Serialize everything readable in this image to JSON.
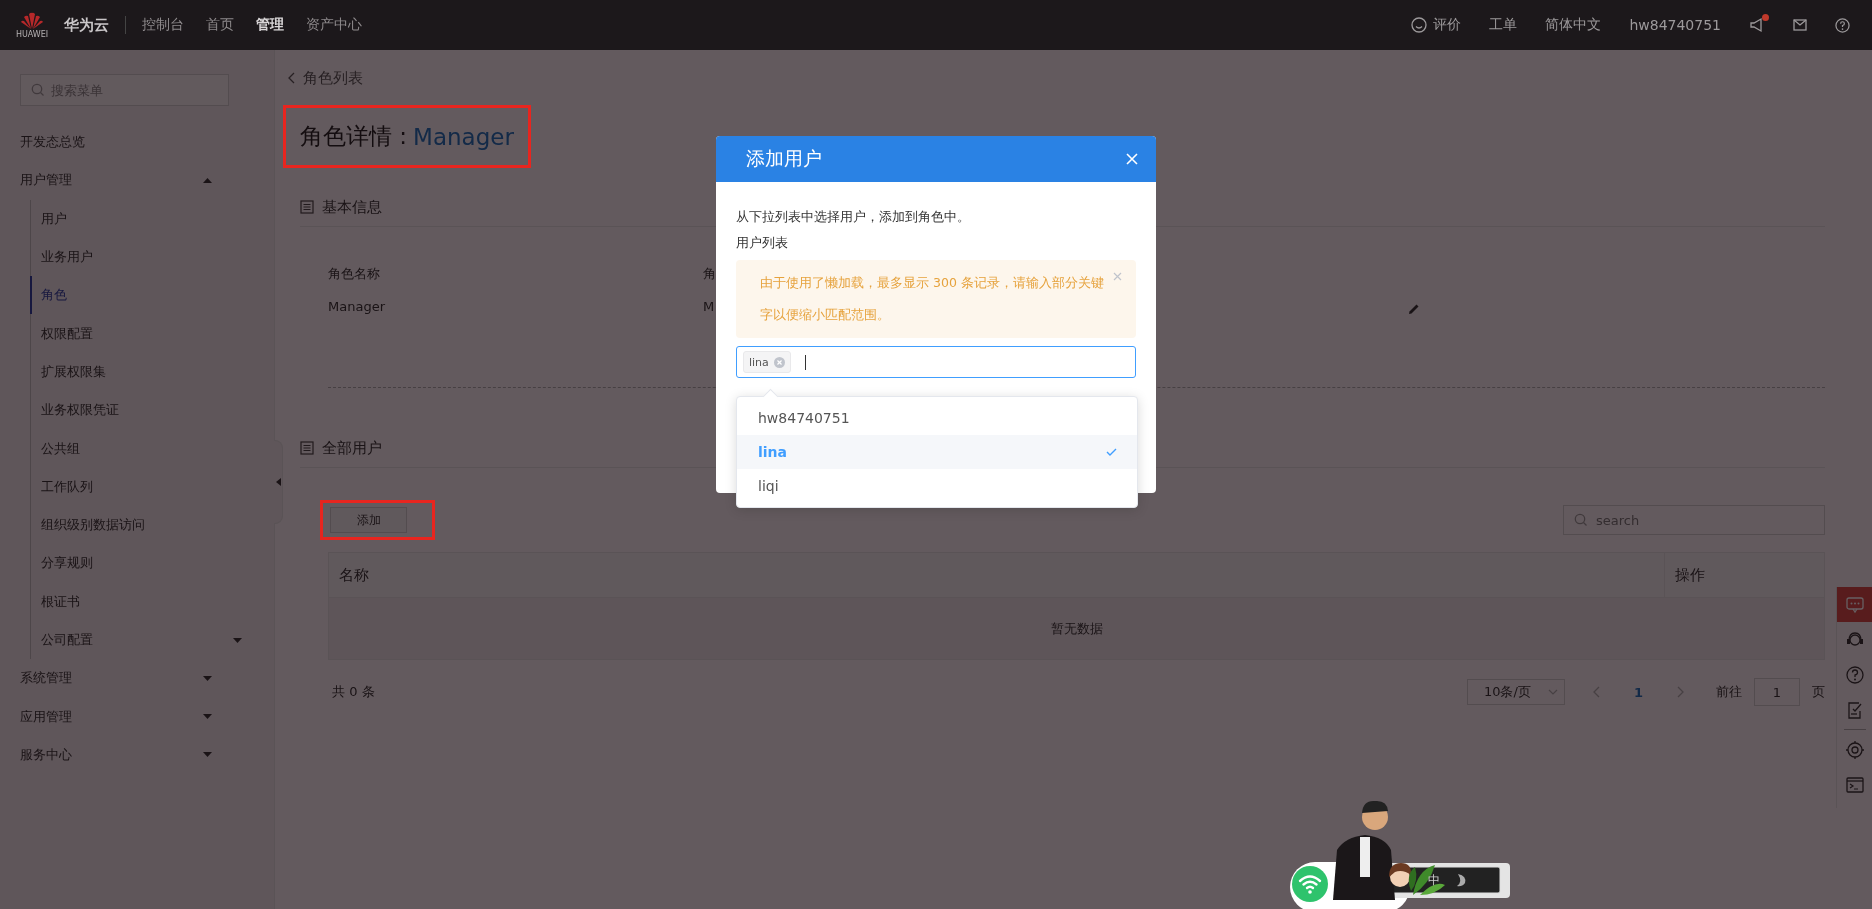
{
  "topbar": {
    "logo_caption": "HUAWEI",
    "brand": "华为云",
    "nav": [
      {
        "label": "控制台",
        "selected": false
      },
      {
        "label": "首页",
        "selected": false
      },
      {
        "label": "管理",
        "selected": true
      },
      {
        "label": "资产中心",
        "selected": false
      }
    ],
    "feedback": "评价",
    "tickets": "工单",
    "language": "简体中文",
    "account": "hw84740751",
    "has_notification": true
  },
  "sidebar": {
    "search_placeholder": "搜索菜单",
    "items": [
      {
        "kind": "link",
        "label": "开发态总览",
        "selected": false
      },
      {
        "kind": "group",
        "label": "用户管理",
        "expanded": true,
        "children": [
          {
            "kind": "link",
            "label": "用户",
            "selected": false
          },
          {
            "kind": "link",
            "label": "业务用户",
            "selected": false
          },
          {
            "kind": "link",
            "label": "角色",
            "selected": true
          },
          {
            "kind": "link",
            "label": "权限配置",
            "selected": false
          },
          {
            "kind": "link",
            "label": "扩展权限集",
            "selected": false
          },
          {
            "kind": "link",
            "label": "业务权限凭证",
            "selected": false
          },
          {
            "kind": "link",
            "label": "公共组",
            "selected": false
          },
          {
            "kind": "link",
            "label": "工作队列",
            "selected": false
          },
          {
            "kind": "link",
            "label": "组织级别数据访问",
            "selected": false
          },
          {
            "kind": "link",
            "label": "分享规则",
            "selected": false
          },
          {
            "kind": "link",
            "label": "根证书",
            "selected": false
          },
          {
            "kind": "group",
            "label": "公司配置",
            "expanded": false
          }
        ]
      },
      {
        "kind": "group",
        "label": "系统管理",
        "expanded": false
      },
      {
        "kind": "group",
        "label": "应用管理",
        "expanded": false
      },
      {
        "kind": "group",
        "label": "服务中心",
        "expanded": false
      }
    ]
  },
  "page": {
    "back_link": "角色列表",
    "title": {
      "heading": "角色详情 :",
      "role_name": "Manager",
      "highlighted": true
    },
    "basic_info": {
      "title": "基本信息",
      "fields": [
        {
          "label": "角色名称",
          "value": "Manager"
        },
        {
          "label": "角",
          "value": "M"
        }
      ]
    },
    "all_users": {
      "title": "全部用户",
      "add_button": {
        "label": "添加",
        "highlighted": true
      },
      "search_placeholder": "search",
      "table": {
        "columns": [
          "名称",
          "操作"
        ],
        "empty_text": "暂无数据"
      },
      "pagination": {
        "total": "共 0 条",
        "page_size": "10条/页",
        "pages": [
          {
            "label": "1",
            "selected": true
          }
        ],
        "goto_label": "前往",
        "goto_value": "1",
        "page_suffix": "页"
      }
    }
  },
  "modal": {
    "title": "添加用户",
    "description": "从下拉列表中选择用户，添加到角色中。",
    "field_label": "用户列表",
    "alert": "由于使用了懒加载，最多显示 300 条记录，请输入部分关键字以便缩小匹配范围。",
    "tags": [
      "lina"
    ],
    "options": [
      {
        "label": "hw84740751",
        "selected": false
      },
      {
        "label": "lina",
        "selected": true
      },
      {
        "label": "liqi",
        "selected": false
      }
    ]
  },
  "ime_toolbar": {
    "mode": "中"
  }
}
